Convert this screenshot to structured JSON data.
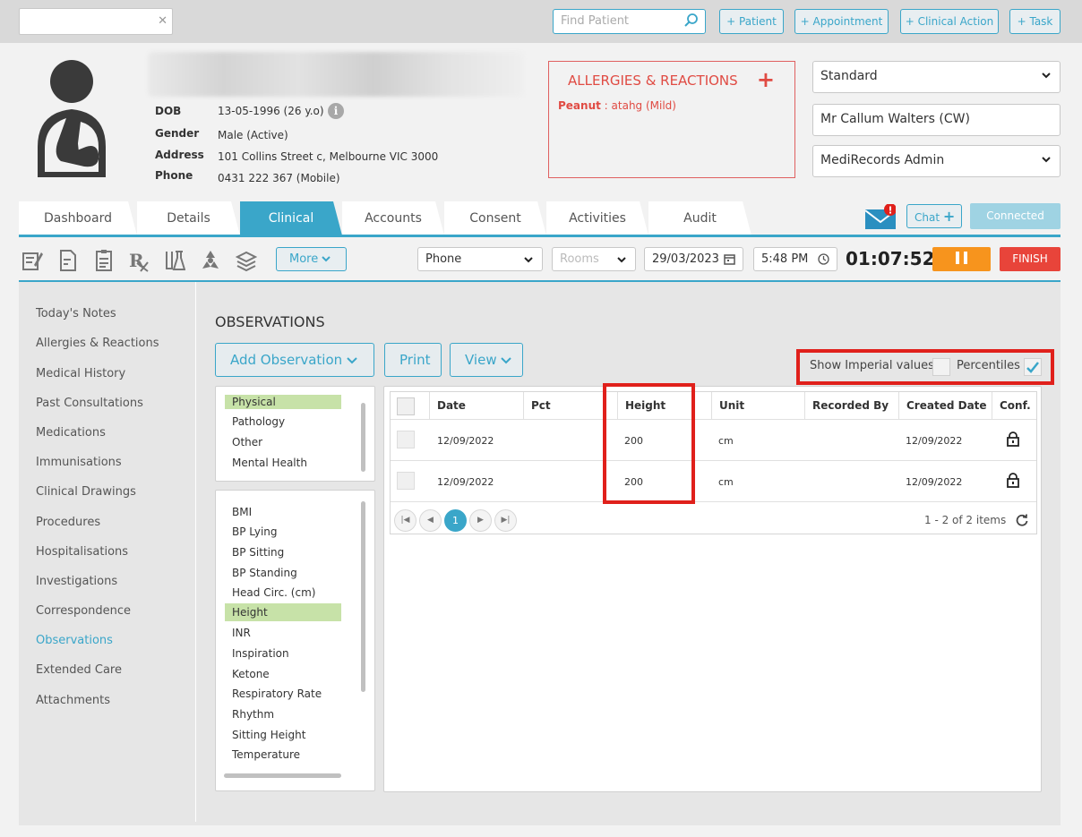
{
  "topbar": {
    "search_value": "",
    "find_placeholder": "Find Patient",
    "buttons": [
      "+ Patient",
      "+ Appointment",
      "+ Clinical Action",
      "+ Task"
    ]
  },
  "patient": {
    "dob_label": "DOB",
    "dob": "13-05-1996 (26 y.o)",
    "gender_label": "Gender",
    "gender": "Male (Active)",
    "address_label": "Address",
    "address": "101 Collins Street c, Melbourne VIC 3000",
    "phone_label": "Phone",
    "phone": "0431 222 367 (Mobile)"
  },
  "allergies": {
    "title": "ALLERGIES & REACTIONS",
    "item_name": "Peanut",
    "item_detail": " : atahg (Mild)"
  },
  "selectors": {
    "standard": "Standard",
    "doctor": "Mr Callum Walters (CW)",
    "admin": "MediRecords Admin"
  },
  "tabs": [
    "Dashboard",
    "Details",
    "Clinical",
    "Accounts",
    "Consent",
    "Activities",
    "Audit"
  ],
  "active_tab": "Clinical",
  "chat": {
    "label": "Chat",
    "connected": "Connected"
  },
  "toolbar": {
    "more": "More",
    "mode": "Phone",
    "rooms_placeholder": "Rooms",
    "date": "29/03/2023",
    "time": "5:48 PM",
    "timer": "01:07:52",
    "finish": "FINISH"
  },
  "nav": [
    "Today's Notes",
    "Allergies & Reactions",
    "Medical History",
    "Past Consultations",
    "Medications",
    "Immunisations",
    "Clinical Drawings",
    "Procedures",
    "Hospitalisations",
    "Investigations",
    "Correspondence",
    "Observations",
    "Extended Care",
    "Attachments"
  ],
  "active_nav": "Observations",
  "observations": {
    "title": "OBSERVATIONS",
    "add": "Add Observation",
    "print": "Print",
    "view": "View",
    "show_imperial": "Show Imperial values",
    "percentiles": "Percentiles",
    "imperial_checked": false,
    "percentiles_checked": true
  },
  "categories": [
    "Physical",
    "Pathology",
    "Other",
    "Mental Health"
  ],
  "selected_category": "Physical",
  "types": [
    "BMI",
    "BP Lying",
    "BP Sitting",
    "BP Standing",
    "Head Circ. (cm)",
    "Height",
    "INR",
    "Inspiration",
    "Ketone",
    "Respiratory Rate",
    "Rhythm",
    "Sitting Height",
    "Temperature"
  ],
  "selected_type": "Height",
  "grid": {
    "columns": [
      "Date",
      "Pct",
      "Height",
      "Unit",
      "Recorded By",
      "Created Date",
      "Conf."
    ],
    "rows": [
      {
        "date": "12/09/2022",
        "pct": "",
        "height": "200",
        "unit": "cm",
        "recorded_by": "",
        "created": "12/09/2022"
      },
      {
        "date": "12/09/2022",
        "pct": "",
        "height": "200",
        "unit": "cm",
        "recorded_by": "",
        "created": "12/09/2022"
      }
    ],
    "page": "1",
    "items_text": "1 - 2 of 2 items"
  }
}
